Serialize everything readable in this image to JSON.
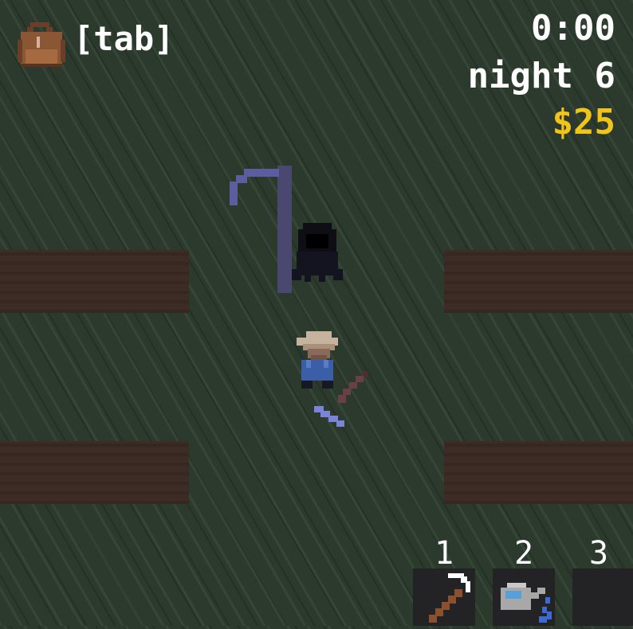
{
  "hud": {
    "inventory_hint": "[tab]",
    "clock": "0:00",
    "night": "night 6",
    "money": "$25",
    "money_color": "#f0c419"
  },
  "hotbar": [
    {
      "number": "1",
      "item": "scythe-icon"
    },
    {
      "number": "2",
      "item": "watering-can-icon"
    },
    {
      "number": "3",
      "item": ""
    }
  ],
  "scene": {
    "ground": "grass",
    "plots": 4,
    "characters": [
      "grim-reaper",
      "farmer"
    ]
  }
}
